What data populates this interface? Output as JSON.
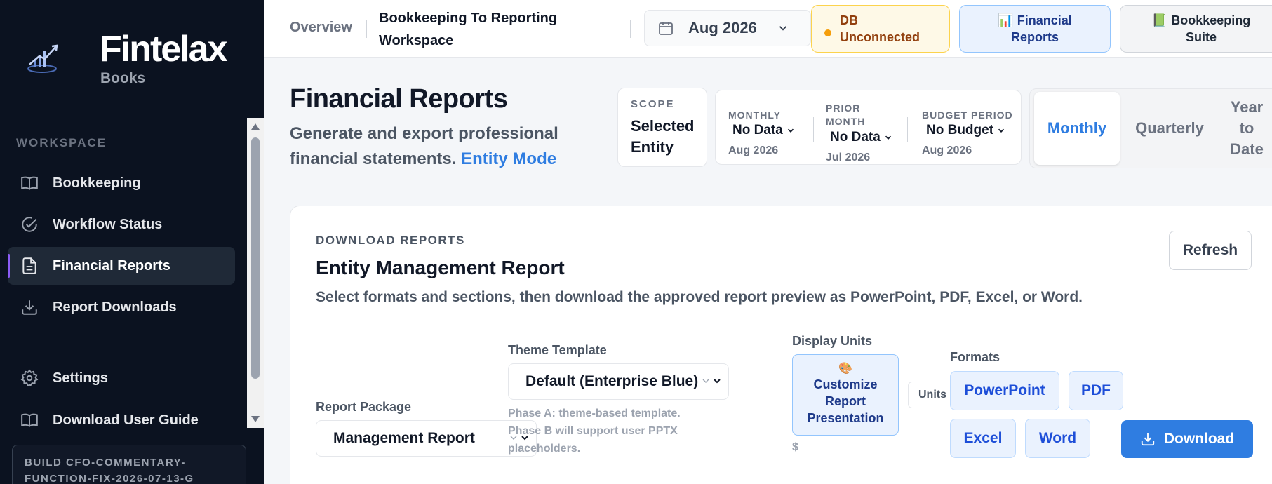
{
  "brand": {
    "name": "Fintelax",
    "subtitle": "Books"
  },
  "sidebar": {
    "section_label": "WORKSPACE",
    "items": [
      {
        "label": "Bookkeeping",
        "icon": "book-icon"
      },
      {
        "label": "Workflow Status",
        "icon": "check-circle-icon"
      },
      {
        "label": "Financial Reports",
        "icon": "document-icon",
        "active": true
      },
      {
        "label": "Report Downloads",
        "icon": "download-icon"
      },
      {
        "label": "Settings",
        "icon": "gear-icon"
      },
      {
        "label": "Download User Guide",
        "icon": "book-icon"
      }
    ],
    "build_line1": "BUILD CFO-COMMENTARY-",
    "build_line2": "FUNCTION-FIX-2026-07-13-G"
  },
  "topbar": {
    "overview": "Overview",
    "workspace": "Bookkeeping To Reporting Workspace",
    "period": "Aug 2026",
    "db_status_line1": "DB",
    "db_status_line2": "Unconnected",
    "financial_btn_line1": "Financial",
    "financial_btn_line2": "Reports",
    "financial_btn_icon": "📊",
    "bookkeeping_btn_line1": "Bookkeeping",
    "bookkeeping_btn_line2": "Suite",
    "bookkeeping_btn_icon": "📗"
  },
  "header": {
    "title": "Financial Reports",
    "subtitle": "Generate and export professional financial statements.",
    "mode": "Entity Mode"
  },
  "scope": {
    "label": "SCOPE",
    "value_line1": "Selected",
    "value_line2": "Entity"
  },
  "periods": {
    "monthly": {
      "label": "MONTHLY",
      "value": "No Data",
      "sub": "Aug 2026"
    },
    "prior": {
      "label_line1": "PRIOR",
      "label_line2": "MONTH",
      "value": "No Data",
      "sub": "Jul 2026"
    },
    "budget": {
      "label": "BUDGET PERIOD",
      "value": "No Budget",
      "sub": "Aug 2026"
    }
  },
  "tabs": {
    "monthly": "Monthly",
    "quarterly": "Quarterly",
    "ytd_line1": "Year",
    "ytd_line2": "to",
    "ytd_line3": "Date"
  },
  "card": {
    "eyebrow": "DOWNLOAD REPORTS",
    "title": "Entity Management Report",
    "description": "Select formats and sections, then download the approved report preview as PowerPoint, PDF, Excel, or Word.",
    "refresh": "Refresh",
    "package_label": "Report Package",
    "package_value": "Management Report",
    "theme_label": "Theme Template",
    "theme_value": "Default (Enterprise Blue)",
    "theme_hint": "Phase A: theme-based template. Phase B will support user PPTX placeholders.",
    "units_label": "Display Units",
    "customize_icon": "🎨",
    "customize_line1": "Customize",
    "customize_line2": "Report",
    "customize_line3": "Presentation",
    "units_symbol": "$",
    "units_pill": "Units",
    "formats_label": "Formats",
    "formats": [
      "PowerPoint",
      "PDF",
      "Excel",
      "Word"
    ],
    "download": "Download"
  },
  "colors": {
    "accent": "#2f7de1",
    "sidebar_bg": "#0b1220",
    "active_marker": "#8b5cf6",
    "db_warning": "#f59e0b"
  }
}
